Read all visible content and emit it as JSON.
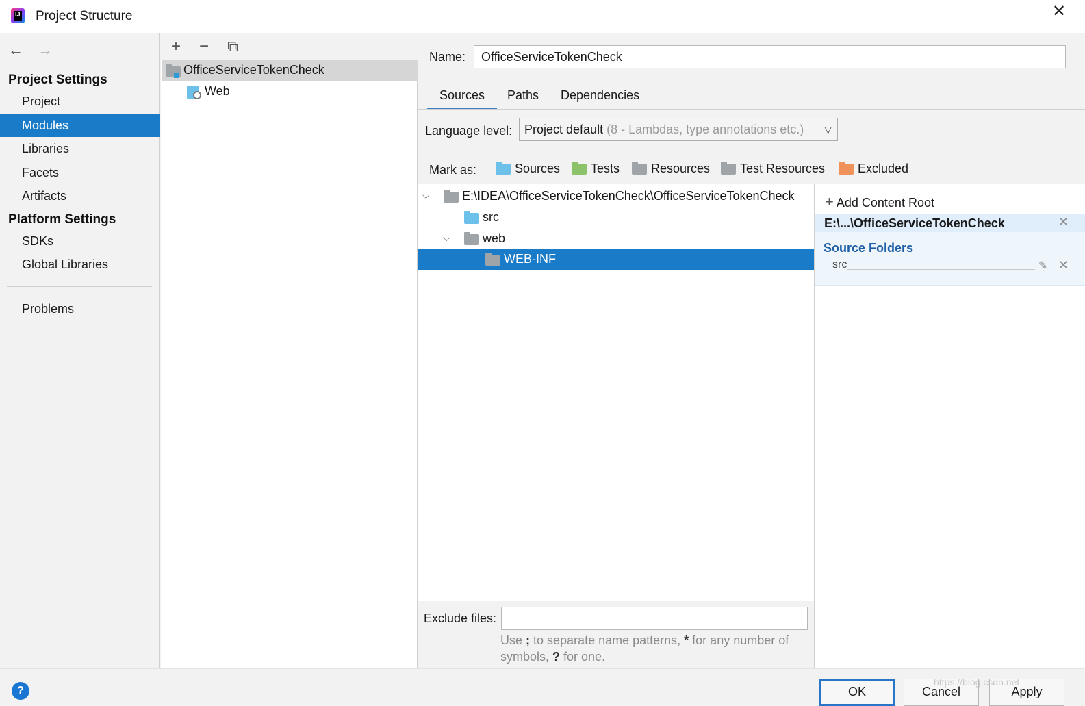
{
  "window": {
    "title": "Project Structure",
    "close_glyph": "✕"
  },
  "nav": {
    "back_glyph": "←",
    "forward_glyph": "→"
  },
  "sidebar": {
    "project_settings_header": "Project Settings",
    "platform_settings_header": "Platform Settings",
    "project_items": [
      {
        "label": "Project"
      },
      {
        "label": "Modules",
        "selected": true
      },
      {
        "label": "Libraries"
      },
      {
        "label": "Facets"
      },
      {
        "label": "Artifacts"
      }
    ],
    "platform_items": [
      {
        "label": "SDKs"
      },
      {
        "label": "Global Libraries"
      }
    ],
    "problems_label": "Problems"
  },
  "module_toolbar": {
    "add_glyph": "+",
    "remove_glyph": "−",
    "copy_glyph": "⧉"
  },
  "module_tree": {
    "module_name": "OfficeServiceTokenCheck",
    "facet_name": "Web"
  },
  "module_editor": {
    "name_label": "Name:",
    "name_value": "OfficeServiceTokenCheck",
    "tabs": [
      {
        "label": "Sources",
        "active": true
      },
      {
        "label": "Paths"
      },
      {
        "label": "Dependencies"
      }
    ],
    "language_level_label": "Language level:",
    "language_level_value": "Project default",
    "language_level_hint": "(8 - Lambdas, type annotations etc.)",
    "mark_as_label": "Mark as:",
    "mark_as": [
      {
        "label": "Sources",
        "color": "#6cc0ea"
      },
      {
        "label": "Tests",
        "color": "#8bc26a"
      },
      {
        "label": "Resources",
        "color": "#9ea4a8"
      },
      {
        "label": "Test Resources",
        "color": "#9ea4a8"
      },
      {
        "label": "Excluded",
        "color": "#f0935a"
      }
    ],
    "content_tree": {
      "root_path": "E:\\IDEA\\OfficeServiceTokenCheck\\OfficeServiceTokenCheck",
      "src": "src",
      "web": "web",
      "web_inf": "WEB-INF"
    },
    "exclude_files_label": "Exclude files:",
    "exclude_files_value": "",
    "exclude_hint_parts": [
      "Use ",
      ";",
      " to separate name patterns, ",
      "*",
      " for any number of symbols, ",
      "?",
      " for one."
    ]
  },
  "roots_panel": {
    "add_content_root": "Add Content Root",
    "content_root": "E:\\...\\OfficeServiceTokenCheck",
    "source_folders_title": "Source Folders",
    "source_folder": "src"
  },
  "bottom": {
    "help_glyph": "?",
    "ok_label": "OK",
    "cancel_label": "Cancel",
    "apply_label": "Apply",
    "watermark": "https://blog.csdn.net"
  },
  "colors": {
    "selection_blue": "#1a7bc8",
    "tab_underline": "#3d7fc6",
    "source_folders_blue": "#1f5fa7"
  }
}
